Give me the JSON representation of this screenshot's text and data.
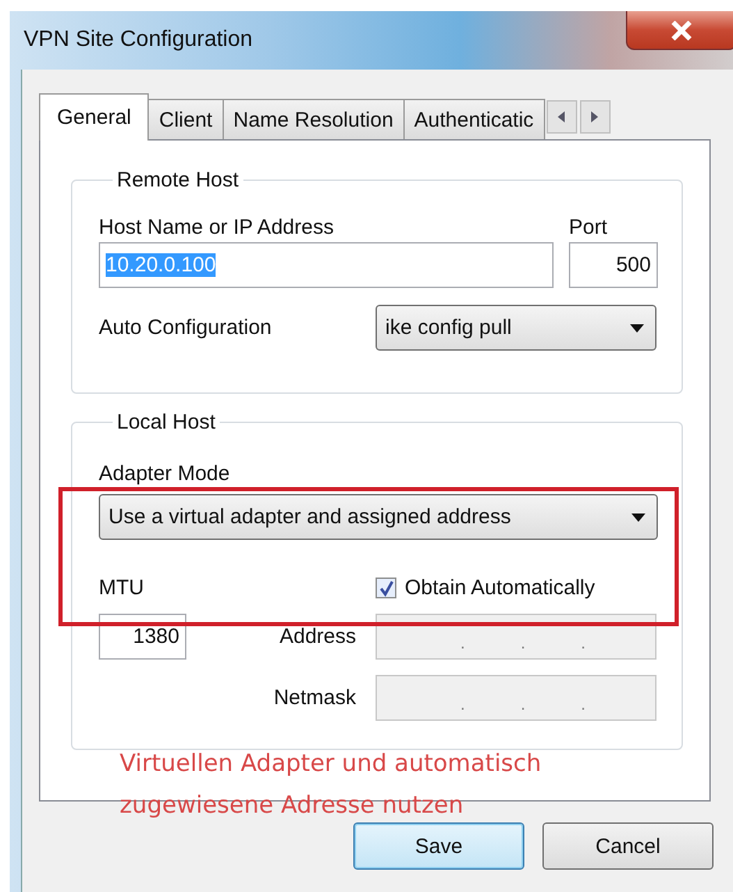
{
  "window": {
    "title": "VPN Site Configuration"
  },
  "tabs": [
    {
      "label": "General",
      "selected": true
    },
    {
      "label": "Client",
      "selected": false
    },
    {
      "label": "Name Resolution",
      "selected": false
    },
    {
      "label": "Authenticatic",
      "selected": false
    }
  ],
  "remote_host": {
    "title": "Remote Host",
    "host_label": "Host Name or IP Address",
    "host_value": "10.20.0.100",
    "host_text_selected": true,
    "port_label": "Port",
    "port_value": "500",
    "auto_config_label": "Auto Configuration",
    "auto_config_value": "ike config pull"
  },
  "local_host": {
    "title": "Local Host",
    "adapter_mode_label": "Adapter Mode",
    "adapter_mode_value": "Use a virtual adapter and assigned address",
    "mtu_label": "MTU",
    "mtu_value": "1380",
    "obtain_automatically": {
      "label": "Obtain Automatically",
      "checked": true
    },
    "address": {
      "label": "Address",
      "disabled": true,
      "separators": [
        ".",
        ".",
        "."
      ]
    },
    "netmask": {
      "label": "Netmask",
      "disabled": true,
      "separators": [
        ".",
        ".",
        "."
      ]
    }
  },
  "annotation": {
    "text": "Virtuellen Adapter und automatisch zugewiesene Adresse nutzen"
  },
  "buttons": [
    {
      "label": "Save",
      "default": true
    },
    {
      "label": "Cancel",
      "default": false
    }
  ]
}
